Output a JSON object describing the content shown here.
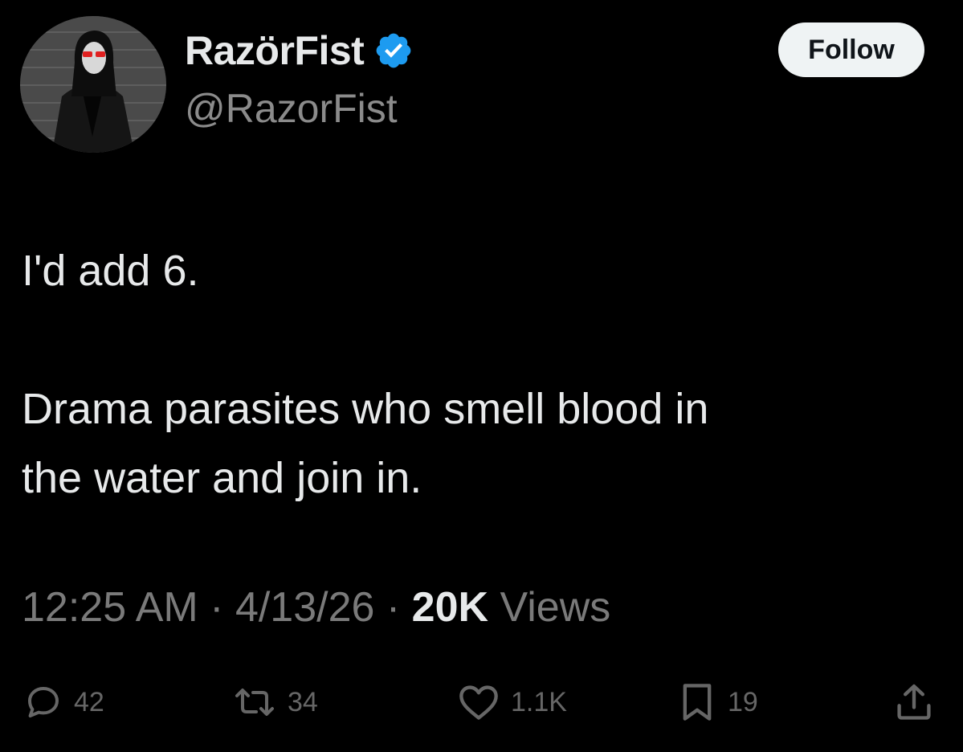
{
  "author": {
    "display_name": "RazörFist",
    "handle": "@RazorFist",
    "verified": true,
    "verified_color": "#1d9bf0"
  },
  "follow_button": {
    "label": "Follow"
  },
  "tweet": {
    "lines": [
      "I'd add 6.",
      "Drama parasites who smell blood in",
      "the water and join in."
    ]
  },
  "meta": {
    "time": "12:25 AM",
    "separator": " · ",
    "date": "4/13/26",
    "views_count": "20K",
    "views_label": " Views"
  },
  "actions": {
    "reply": {
      "icon": "reply-icon",
      "count": "42"
    },
    "retweet": {
      "icon": "retweet-icon",
      "count": "34"
    },
    "like": {
      "icon": "heart-icon",
      "count": "1.1K"
    },
    "bookmark": {
      "icon": "bookmark-icon",
      "count": "19"
    },
    "share": {
      "icon": "share-icon"
    }
  },
  "colors": {
    "background": "#000000",
    "text_primary": "#e7e9ea",
    "text_secondary": "#8b8b8b",
    "action_gray": "#666666"
  }
}
